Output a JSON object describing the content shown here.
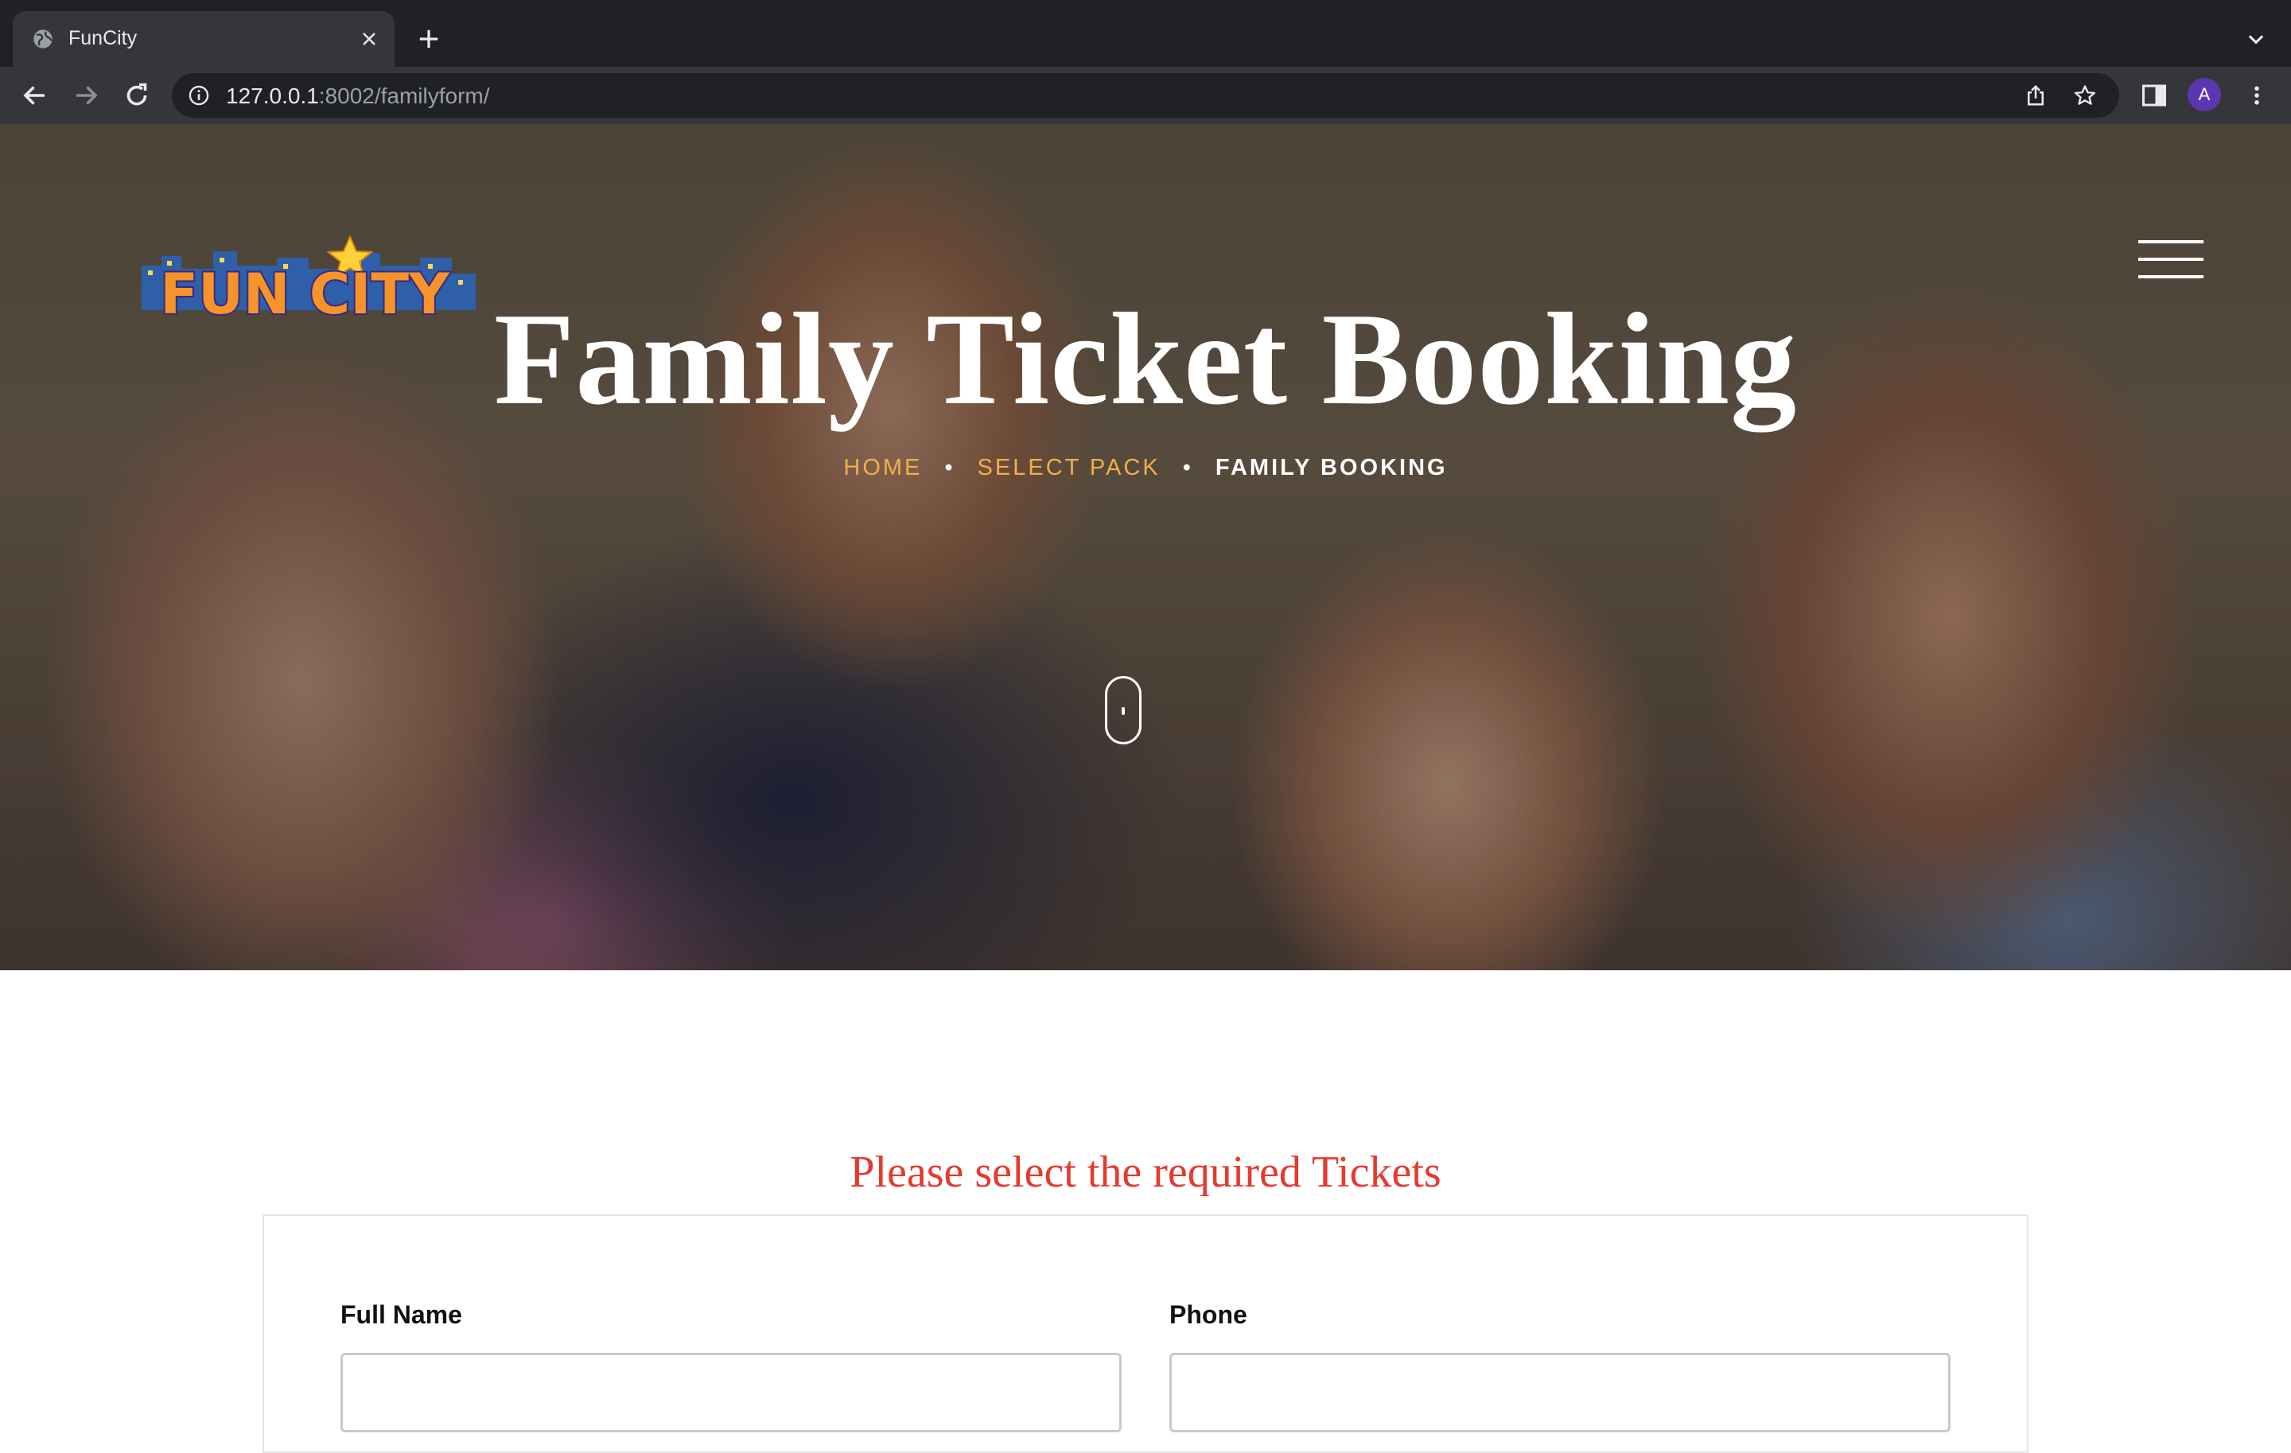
{
  "browser": {
    "tab_title": "FunCity",
    "url_host": "127.0.0.1",
    "url_path": ":8002/familyform/",
    "avatar_letter": "A"
  },
  "hero": {
    "logo_text": "FUN CITY",
    "title": "Family Ticket Booking",
    "breadcrumb": {
      "home": "HOME",
      "select_pack": "SELECT PACK",
      "current": "FAMILY BOOKING",
      "separator": "•"
    }
  },
  "form": {
    "heading": "Please select the required Tickets",
    "full_name_label": "Full Name",
    "full_name_value": "",
    "phone_label": "Phone",
    "phone_value": ""
  },
  "colors": {
    "breadcrumb_link": "#f0b04a",
    "heading_red": "#e53a2f",
    "chrome_dark": "#202124",
    "chrome_toolbar": "#35363a"
  }
}
